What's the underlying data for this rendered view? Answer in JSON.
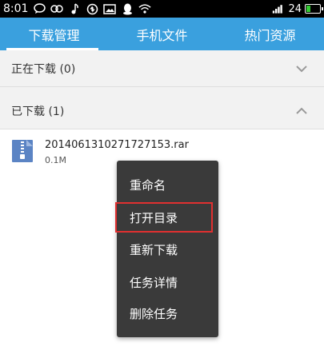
{
  "status_bar": {
    "time": "8:01",
    "icons": [
      "chat-bubble-icon",
      "infinity-icon",
      "music-note-icon",
      "sync-icon",
      "image-icon",
      "penguin-icon",
      "wifi-icon",
      "signal-icon"
    ],
    "battery_level": "24",
    "battery_color": "#33cc33"
  },
  "tabs": [
    {
      "label": "下载管理",
      "active": true
    },
    {
      "label": "手机文件",
      "active": false
    },
    {
      "label": "热门资源",
      "active": false
    }
  ],
  "sections": {
    "downloading": {
      "label": "正在下载 (0)"
    },
    "downloaded": {
      "label": "已下载 (1)"
    }
  },
  "file": {
    "name": "20140613102717271​53.rar",
    "size": "0.1M"
  },
  "context_menu": {
    "items": [
      "重命名",
      "打开目录",
      "重新下载",
      "任务详情",
      "删除任务"
    ],
    "highlighted_index": 1
  },
  "colors": {
    "accent": "#3aa0de",
    "menu_bg": "#3a3a3a",
    "highlight_border": "#e03030"
  }
}
